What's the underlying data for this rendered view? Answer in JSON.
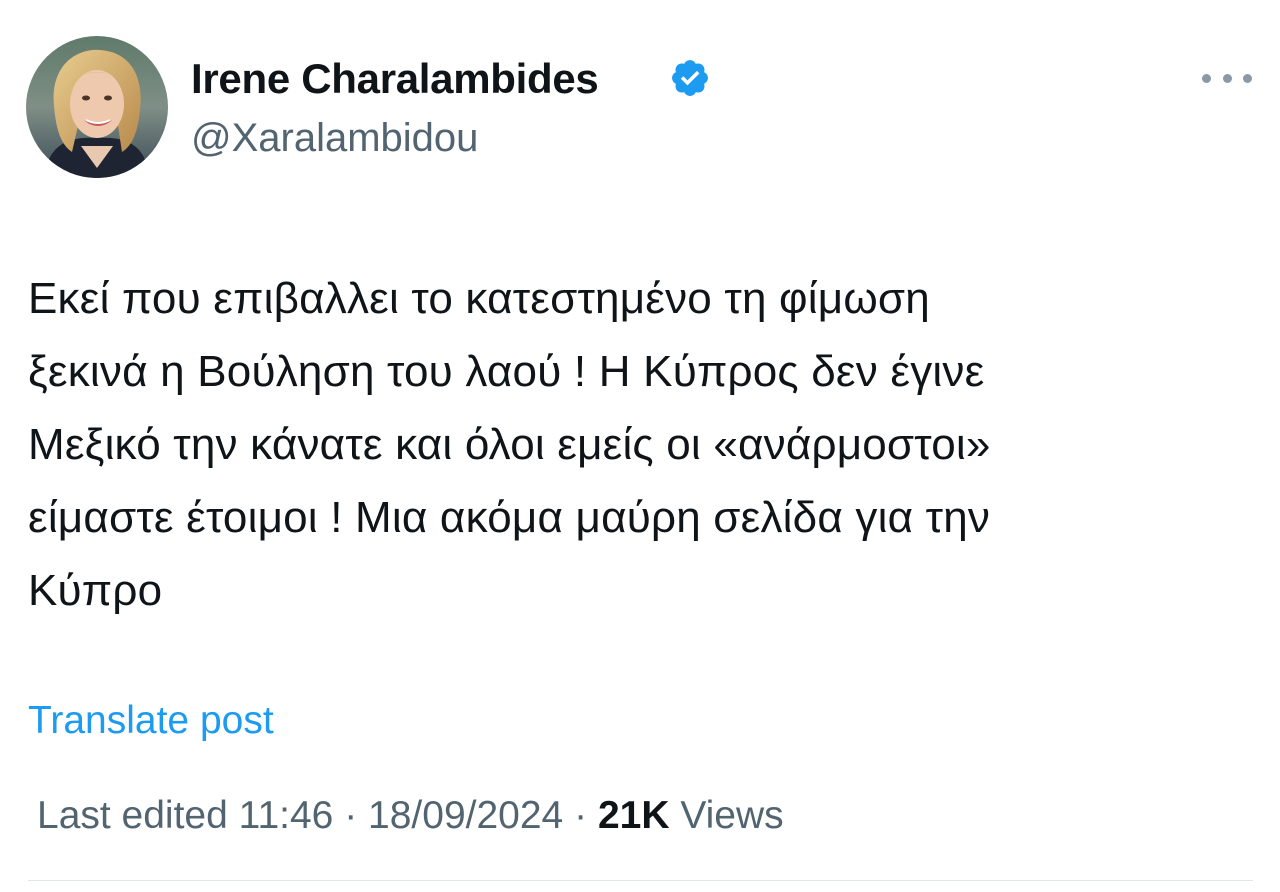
{
  "author": {
    "display_name": "Irene Charalambides",
    "handle": "@Xaralambidou",
    "verified": true,
    "verified_color": "#1d9bf0",
    "avatar_icon": "profile-photo"
  },
  "menu": {
    "icon": "more-horizontal-icon"
  },
  "tweet": {
    "lines": [
      "Εκεί που επιβαλλει το κατεστημένο τη φίμωση",
      "ξεκινά η Βούληση του λαού ! Η Κύπρος δεν έγινε",
      "Μεξικό την κάνατε και όλοι εμείς οι «ανάρμοστοι»",
      "είμαστε έτοιμοι ! Μια ακόμα μαύρη σελίδα για την",
      "Κύπρο"
    ]
  },
  "translate": {
    "label": "Translate post",
    "color": "#1d9bf0"
  },
  "meta": {
    "edited_label": "Last edited",
    "time": "11:46",
    "separator": "·",
    "date": "18/09/2024",
    "views_count": "21K",
    "views_label": "Views"
  },
  "colors": {
    "text": "#0f1419",
    "secondary": "#536471"
  }
}
